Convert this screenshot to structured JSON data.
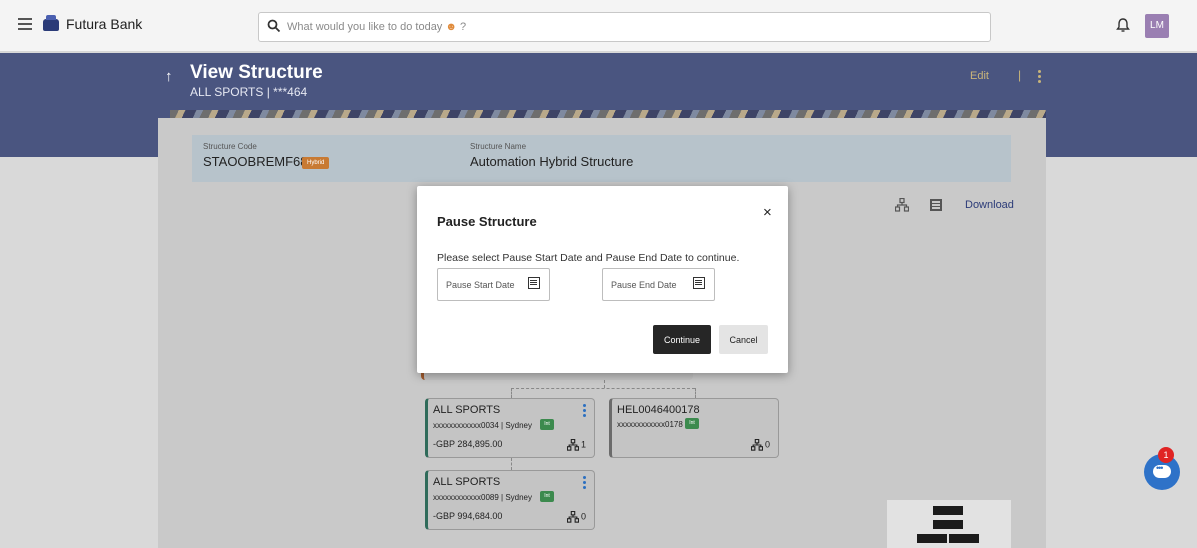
{
  "topbar": {
    "brand": "Futura Bank",
    "search_placeholder": "What would you like to do today",
    "search_suffix": "?",
    "avatar_initials": "LM"
  },
  "header": {
    "title": "View Structure",
    "subtitle": "ALL SPORTS | ***464",
    "edit_label": "Edit",
    "separator": "|"
  },
  "structure": {
    "code_label": "Structure Code",
    "code_value": "STAOOBREMF68",
    "type_badge": "Hybrid",
    "name_label": "Structure Name",
    "name_value": "Automation Hybrid Structure",
    "download_label": "Download"
  },
  "nodes": [
    {
      "title": "ALL SPORTS",
      "account": "xxxxxxxxxxxx0034 | Sydney",
      "tag": "Int",
      "amount": "-GBP 284,895.00",
      "children": "1"
    },
    {
      "title": "HEL0046400178",
      "account": "xxxxxxxxxxxx0178",
      "tag": "Int",
      "amount": "",
      "children": "0"
    },
    {
      "title": "ALL SPORTS",
      "account": "xxxxxxxxxxxx0089 | Sydney",
      "tag": "Int",
      "amount": "-GBP 994,684.00",
      "children": "0"
    }
  ],
  "chat": {
    "badge_count": "1"
  },
  "modal": {
    "title": "Pause Structure",
    "message": "Please select Pause Start Date and Pause End Date to continue.",
    "start_placeholder": "Pause Start Date",
    "end_placeholder": "Pause End Date",
    "continue_label": "Continue",
    "cancel_label": "Cancel",
    "close_symbol": "×"
  }
}
